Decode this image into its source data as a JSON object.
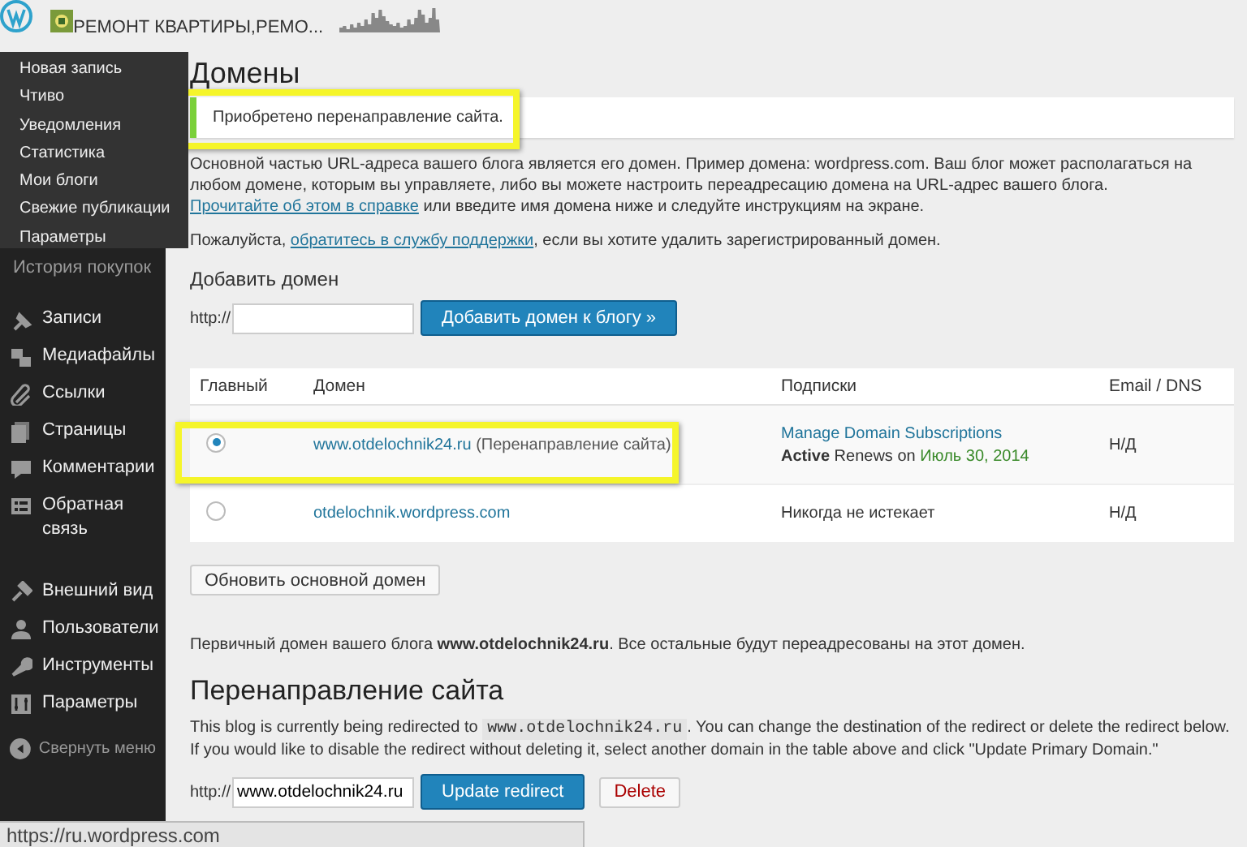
{
  "topbar": {
    "site_name": "РЕМОНТ КВАРТИРЫ,РЕМО..."
  },
  "flyout_menu": [
    {
      "label": "Новая запись"
    },
    {
      "label": "Чтиво"
    },
    {
      "label": "Уведомления"
    },
    {
      "label": "Статистика"
    },
    {
      "label": "Мои блоги"
    },
    {
      "label": "Свежие публикации"
    },
    {
      "label": "Параметры"
    }
  ],
  "sidebar": {
    "top_item": "История покупок",
    "items": [
      {
        "label": "Записи"
      },
      {
        "label": "Медиафайлы"
      },
      {
        "label": "Ссылки"
      },
      {
        "label": "Страницы"
      },
      {
        "label": "Комментарии"
      },
      {
        "label": "Обратная связь"
      },
      {
        "label": "Внешний вид"
      },
      {
        "label": "Пользователи"
      },
      {
        "label": "Инструменты"
      },
      {
        "label": "Параметры"
      }
    ],
    "collapse": "Свернуть меню"
  },
  "page": {
    "title": "Домены",
    "notice": "Приобретено перенаправление сайта.",
    "intro": {
      "before": "Основной частью URL-адреса вашего блога является его домен. Пример домена: wordpress.com. Ваш блог может располагаться на любом домене, которым вы управляете, либо вы можете настроить переадресацию домена на URL-адрес вашего блога. ",
      "link": "Прочитайте об этом в справке",
      "after": " или введите имя домена ниже и следуйте инструкциям на экране."
    },
    "support": {
      "before": "Пожалуйста, ",
      "link": "обратитесь в службу поддержки",
      "after": ", если вы хотите удалить зарегистрированный домен."
    },
    "add_domain": {
      "label": "Добавить домен",
      "prefix": "http://",
      "button": "Добавить домен к блогу »"
    },
    "table": {
      "columns": [
        "Главный",
        "Домен",
        "Подписки",
        "Email / DNS"
      ],
      "rows": [
        {
          "selected": true,
          "domain": "www.otdelochnik24.ru",
          "note": "(Перенаправление сайта)",
          "kind": "managed",
          "subscription": {
            "link": "Manage Domain Subscriptions",
            "status": "Active",
            "renews": "Renews on",
            "date": "Июль 30, 2014"
          },
          "email": "Н/Д"
        },
        {
          "selected": false,
          "domain": "otdelochnik.wordpress.com",
          "kind": "plain",
          "subscription": {
            "text": "Никогда не истекает"
          },
          "email": "Н/Д"
        }
      ]
    },
    "update_button": "Обновить основной домен",
    "primary_note": "Первичный домен вашего блога **www.otdelochnik24.ru**. Все остальные будут переадресованы на этот домен.",
    "redirect": {
      "title": "Перенаправление сайта",
      "text_before": "This blog is currently being redirected to ",
      "code": "www.otdelochnik24.ru",
      "text_after": ". You can change the destination of the redirect or delete the redirect below. If you would like to disable the redirect without deleting it, select another domain in the table above and click \"Update Primary Domain.\"",
      "prefix": "http://",
      "value": "www.otdelochnik24.ru",
      "update_button": "Update redirect",
      "delete_button": "Delete"
    }
  },
  "status_bar": {
    "url": "https://ru.wordpress.com"
  }
}
